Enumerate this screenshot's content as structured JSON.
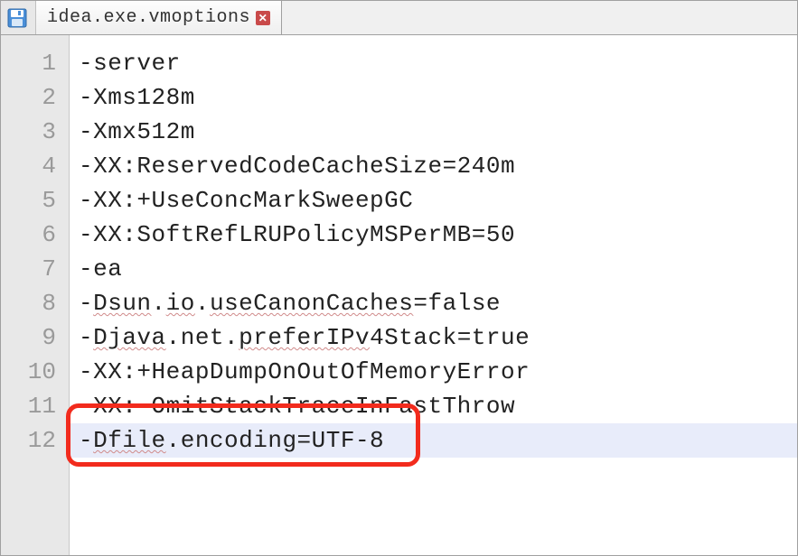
{
  "tab": {
    "filename": "idea.exe.vmoptions"
  },
  "gutter": {
    "lines": [
      "1",
      "2",
      "3",
      "4",
      "5",
      "6",
      "7",
      "8",
      "9",
      "10",
      "11",
      "12"
    ]
  },
  "code": {
    "lines": [
      "-server",
      "-Xms128m",
      "-Xmx512m",
      "-XX:ReservedCodeCacheSize=240m",
      "-XX:+UseConcMarkSweepGC",
      "-XX:SoftRefLRUPolicyMSPerMB=50",
      "-ea",
      "-Dsun.io.useCanonCaches=false",
      "-Djava.net.preferIPv4Stack=true",
      "-XX:+HeapDumpOnOutOfMemoryError",
      "-XX:-OmitStackTraceInFastThrow",
      "-Dfile.encoding=UTF-8"
    ]
  },
  "highlight": {
    "line_index": 11
  }
}
